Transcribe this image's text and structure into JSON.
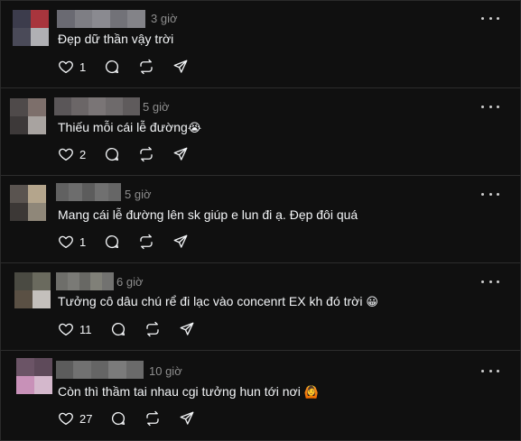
{
  "comments": [
    {
      "time": "3 giờ",
      "text": "Đẹp dữ thần vậy trời",
      "emoji": "",
      "likes": "1",
      "avatar_colors": [
        "#3c3c4c",
        "#a8353d",
        "#4a4a58",
        "#b0b0b4"
      ],
      "name_colors": [
        "#6a6a72",
        "#7e7e84",
        "#8a8a90",
        "#727278",
        "#838388"
      ]
    },
    {
      "time": "5 giờ",
      "text": "Thiếu mỗi cái lễ đường",
      "emoji": "😭",
      "likes": "2",
      "avatar_colors": [
        "#4f4a4a",
        "#7d6f6b",
        "#3d3939",
        "#a8a3a0"
      ],
      "name_colors": [
        "#5a5658",
        "#6b6667",
        "#7a7576",
        "#6e6a6b",
        "#5f5b5c"
      ]
    },
    {
      "time": "5 giờ",
      "text": "Mang cái lễ đường lên sk giúp e lun đi ạ. Đẹp đôi quá",
      "emoji": "",
      "likes": "1",
      "avatar_colors": [
        "#5a5450",
        "#b4a58c",
        "#3c3836",
        "#8f8779"
      ],
      "name_colors": [
        "#616161",
        "#6d6d6d",
        "#5c5c5c",
        "#707070",
        "#666666"
      ]
    },
    {
      "time": "6 giờ",
      "text": "Tưởng cô dâu chú rể đi lạc vào concenrt EX kh đó trời",
      "emoji": "😀",
      "likes": "11",
      "avatar_colors": [
        "#4a4a42",
        "#6a6a5e",
        "#5a5044",
        "#c4c0bc"
      ],
      "name_colors": [
        "#6e6e6a",
        "#7a7a76",
        "#686864",
        "#808078",
        "#727270"
      ]
    },
    {
      "time": "10 giờ",
      "text": "Còn thì thầm tai nhau cgi tưởng hun tới nơi",
      "emoji": "🙆",
      "likes": "27",
      "avatar_colors": [
        "#6b5466",
        "#5e4a5a",
        "#c891b8",
        "#d4b8cc"
      ],
      "name_colors": [
        "#5c5c5c",
        "#717171",
        "#656565",
        "#7b7b7b",
        "#6a6a6a"
      ]
    }
  ],
  "icons": {
    "like": "heart-icon",
    "reply": "comment-icon",
    "repost": "repost-icon",
    "share": "send-icon",
    "more": "more-icon"
  }
}
